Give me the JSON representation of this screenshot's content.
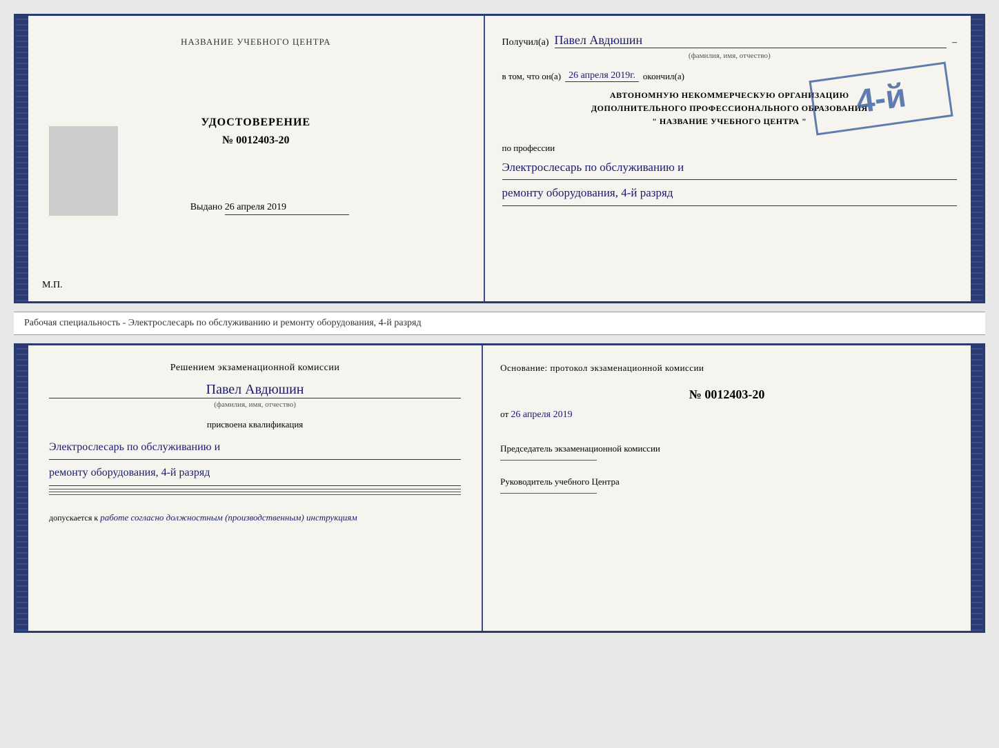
{
  "page": {
    "background": "#e8e8e8"
  },
  "topBooklet": {
    "leftPage": {
      "orgNameTop": "НАЗВАНИЕ УЧЕБНОГО ЦЕНТРА",
      "certTitle": "УДОСТОВЕРЕНИЕ",
      "certNumberLabel": "№",
      "certNumber": "0012403-20",
      "issuedLabel": "Выдано",
      "issuedDate": "26 апреля 2019",
      "mpLabel": "М.П."
    },
    "rightPage": {
      "receivedLabel": "Получил(а)",
      "personName": "Павел Авдюшин",
      "fioSubtitle": "(фамилия, имя, отчество)",
      "inThatLabel": "в том, что он(а)",
      "inThatDate": "26 апреля 2019г.",
      "finishedLabel": "окончил(а)",
      "orgLine1": "АВТОНОМНУЮ НЕКОММЕРЧЕСКУЮ ОРГАНИЗАЦИЮ",
      "orgLine2": "ДОПОЛНИТЕЛЬНОГО ПРОФЕССИОНАЛЬНОГО ОБРАЗОВАНИЯ",
      "orgLine3": "\" НАЗВАНИЕ УЧЕБНОГО ЦЕНТРА \"",
      "professionLabel": "по профессии",
      "professionLine1": "Электрослесарь по обслуживанию и",
      "professionLine2": "ремонту оборудования, 4-й разряд",
      "stampNumber": "4-й"
    }
  },
  "middleLabel": {
    "text": "Рабочая специальность - Электрослесарь по обслуживанию и ремонту оборудования, 4-й разряд"
  },
  "bottomBooklet": {
    "leftPage": {
      "decisionTitle": "Решением экзаменационной комиссии",
      "personName": "Павел Авдюшин",
      "fioSubtitle": "(фамилия, имя, отчество)",
      "assignedText": "присвоена квалификация",
      "qualLine1": "Электрослесарь по обслуживанию и",
      "qualLine2": "ремонту оборудования, 4-й разряд",
      "allowedLabel": "допускается к",
      "allowedText": "работе согласно должностным (производственным) инструкциям"
    },
    "rightPage": {
      "basisTitle": "Основание: протокол экзаменационной комиссии",
      "numberLabel": "№",
      "basisNumber": "0012403-20",
      "dateFromLabel": "от",
      "basisDate": "26 апреля 2019",
      "chairmanTitle": "Председатель экзаменационной комиссии",
      "headTitle": "Руководитель учебного Центра"
    }
  }
}
